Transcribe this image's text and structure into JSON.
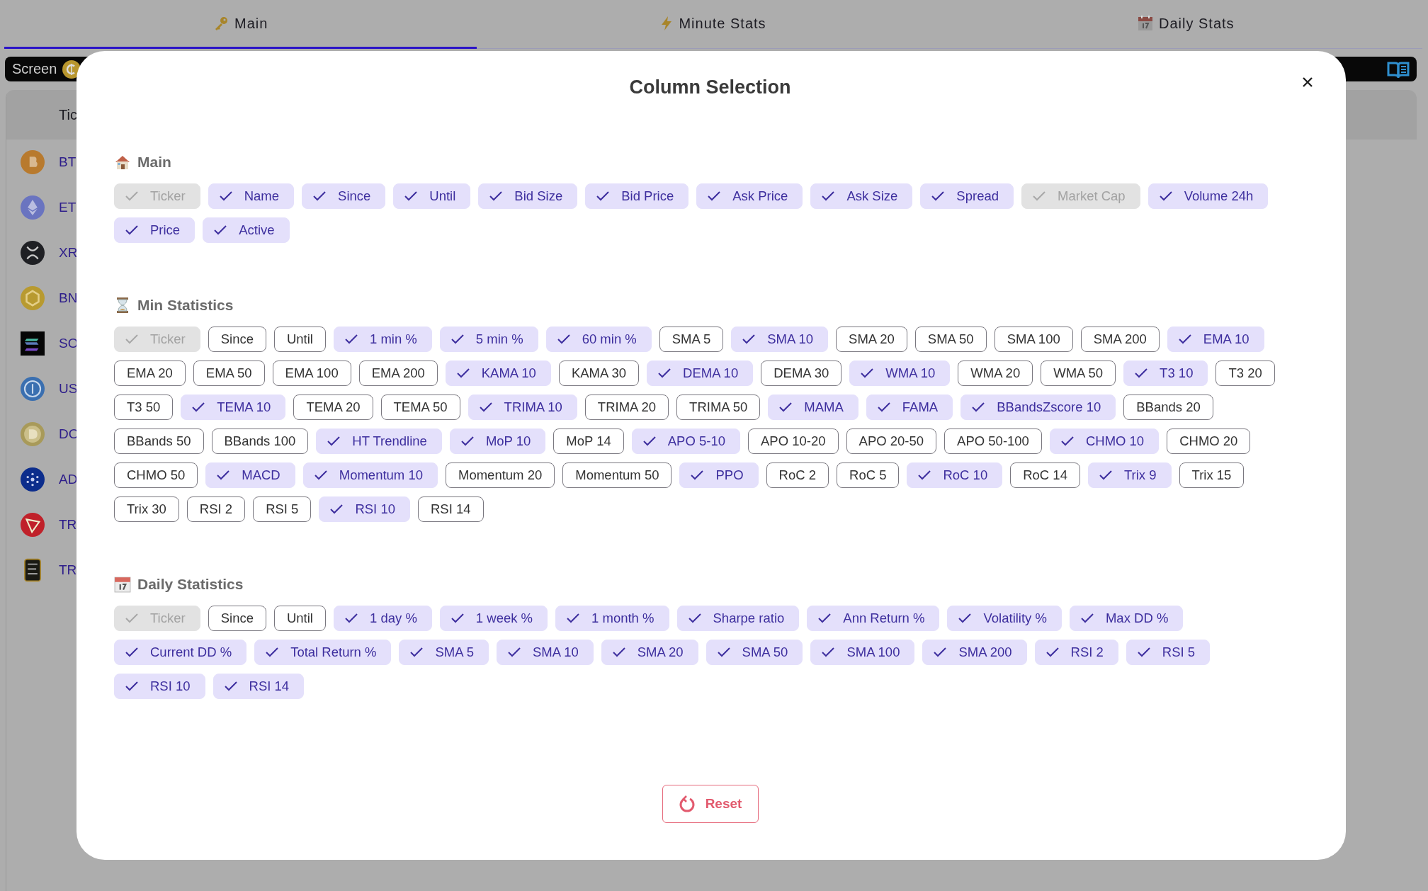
{
  "tabs": [
    {
      "label": "Main",
      "selected": true
    },
    {
      "label": "Minute Stats",
      "selected": false
    },
    {
      "label": "Daily Stats",
      "selected": false
    }
  ],
  "toolbar": {
    "label": "Screen"
  },
  "table": {
    "columns": [
      "Tic"
    ],
    "rows": [
      "BT",
      "ET",
      "XR",
      "BN",
      "SO",
      "US",
      "DO",
      "AD",
      "TR",
      "TR"
    ]
  },
  "modal": {
    "title": "Column Selection",
    "sections": [
      {
        "title": "Main",
        "chips": [
          {
            "label": "Ticker",
            "checked": true,
            "disabled": true
          },
          {
            "label": "Name",
            "checked": true,
            "disabled": false
          },
          {
            "label": "Since",
            "checked": true,
            "disabled": false
          },
          {
            "label": "Until",
            "checked": true,
            "disabled": false
          },
          {
            "label": "Bid Size",
            "checked": true,
            "disabled": false
          },
          {
            "label": "Bid Price",
            "checked": true,
            "disabled": false
          },
          {
            "label": "Ask Price",
            "checked": true,
            "disabled": false
          },
          {
            "label": "Ask Size",
            "checked": true,
            "disabled": false
          },
          {
            "label": "Spread",
            "checked": true,
            "disabled": false
          },
          {
            "label": "Market Cap",
            "checked": true,
            "disabled": true
          },
          {
            "label": "Volume 24h",
            "checked": true,
            "disabled": false
          },
          {
            "label": "Price",
            "checked": true,
            "disabled": false
          },
          {
            "label": "Active",
            "checked": true,
            "disabled": false
          }
        ]
      },
      {
        "title": "Min Statistics",
        "chips": [
          {
            "label": "Ticker",
            "checked": true,
            "disabled": true
          },
          {
            "label": "Since",
            "checked": false,
            "disabled": false
          },
          {
            "label": "Until",
            "checked": false,
            "disabled": false
          },
          {
            "label": "1 min %",
            "checked": true,
            "disabled": false
          },
          {
            "label": "5 min %",
            "checked": true,
            "disabled": false
          },
          {
            "label": "60 min %",
            "checked": true,
            "disabled": false
          },
          {
            "label": "SMA 5",
            "checked": false,
            "disabled": false
          },
          {
            "label": "SMA 10",
            "checked": true,
            "disabled": false
          },
          {
            "label": "SMA 20",
            "checked": false,
            "disabled": false
          },
          {
            "label": "SMA 50",
            "checked": false,
            "disabled": false
          },
          {
            "label": "SMA 100",
            "checked": false,
            "disabled": false
          },
          {
            "label": "SMA 200",
            "checked": false,
            "disabled": false
          },
          {
            "label": "EMA 10",
            "checked": true,
            "disabled": false
          },
          {
            "label": "EMA 20",
            "checked": false,
            "disabled": false
          },
          {
            "label": "EMA 50",
            "checked": false,
            "disabled": false
          },
          {
            "label": "EMA 100",
            "checked": false,
            "disabled": false
          },
          {
            "label": "EMA 200",
            "checked": false,
            "disabled": false
          },
          {
            "label": "KAMA 10",
            "checked": true,
            "disabled": false
          },
          {
            "label": "KAMA 30",
            "checked": false,
            "disabled": false
          },
          {
            "label": "DEMA 10",
            "checked": true,
            "disabled": false
          },
          {
            "label": "DEMA 30",
            "checked": false,
            "disabled": false
          },
          {
            "label": "WMA 10",
            "checked": true,
            "disabled": false
          },
          {
            "label": "WMA 20",
            "checked": false,
            "disabled": false
          },
          {
            "label": "WMA 50",
            "checked": false,
            "disabled": false
          },
          {
            "label": "T3 10",
            "checked": true,
            "disabled": false
          },
          {
            "label": "T3 20",
            "checked": false,
            "disabled": false
          },
          {
            "label": "T3 50",
            "checked": false,
            "disabled": false
          },
          {
            "label": "TEMA 10",
            "checked": true,
            "disabled": false
          },
          {
            "label": "TEMA 20",
            "checked": false,
            "disabled": false
          },
          {
            "label": "TEMA 50",
            "checked": false,
            "disabled": false
          },
          {
            "label": "TRIMA 10",
            "checked": true,
            "disabled": false
          },
          {
            "label": "TRIMA 20",
            "checked": false,
            "disabled": false
          },
          {
            "label": "TRIMA 50",
            "checked": false,
            "disabled": false
          },
          {
            "label": "MAMA",
            "checked": true,
            "disabled": false
          },
          {
            "label": "FAMA",
            "checked": true,
            "disabled": false
          },
          {
            "label": "BBandsZscore 10",
            "checked": true,
            "disabled": false
          },
          {
            "label": "BBands 20",
            "checked": false,
            "disabled": false
          },
          {
            "label": "BBands 50",
            "checked": false,
            "disabled": false
          },
          {
            "label": "BBands 100",
            "checked": false,
            "disabled": false
          },
          {
            "label": "HT Trendline",
            "checked": true,
            "disabled": false
          },
          {
            "label": "MoP 10",
            "checked": true,
            "disabled": false
          },
          {
            "label": "MoP 14",
            "checked": false,
            "disabled": false
          },
          {
            "label": "APO 5-10",
            "checked": true,
            "disabled": false
          },
          {
            "label": "APO 10-20",
            "checked": false,
            "disabled": false
          },
          {
            "label": "APO 20-50",
            "checked": false,
            "disabled": false
          },
          {
            "label": "APO 50-100",
            "checked": false,
            "disabled": false
          },
          {
            "label": "CHMO 10",
            "checked": true,
            "disabled": false
          },
          {
            "label": "CHMO 20",
            "checked": false,
            "disabled": false
          },
          {
            "label": "CHMO 50",
            "checked": false,
            "disabled": false
          },
          {
            "label": "MACD",
            "checked": true,
            "disabled": false
          },
          {
            "label": "Momentum 10",
            "checked": true,
            "disabled": false
          },
          {
            "label": "Momentum 20",
            "checked": false,
            "disabled": false
          },
          {
            "label": "Momentum 50",
            "checked": false,
            "disabled": false
          },
          {
            "label": "PPO",
            "checked": true,
            "disabled": false
          },
          {
            "label": "RoC 2",
            "checked": false,
            "disabled": false
          },
          {
            "label": "RoC 5",
            "checked": false,
            "disabled": false
          },
          {
            "label": "RoC 10",
            "checked": true,
            "disabled": false
          },
          {
            "label": "RoC 14",
            "checked": false,
            "disabled": false
          },
          {
            "label": "Trix 9",
            "checked": true,
            "disabled": false
          },
          {
            "label": "Trix 15",
            "checked": false,
            "disabled": false
          },
          {
            "label": "Trix 30",
            "checked": false,
            "disabled": false
          },
          {
            "label": "RSI 2",
            "checked": false,
            "disabled": false
          },
          {
            "label": "RSI 5",
            "checked": false,
            "disabled": false
          },
          {
            "label": "RSI 10",
            "checked": true,
            "disabled": false
          },
          {
            "label": "RSI 14",
            "checked": false,
            "disabled": false
          }
        ]
      },
      {
        "title": "Daily Statistics",
        "chips": [
          {
            "label": "Ticker",
            "checked": true,
            "disabled": true
          },
          {
            "label": "Since",
            "checked": false,
            "disabled": false
          },
          {
            "label": "Until",
            "checked": false,
            "disabled": false
          },
          {
            "label": "1 day %",
            "checked": true,
            "disabled": false
          },
          {
            "label": "1 week %",
            "checked": true,
            "disabled": false
          },
          {
            "label": "1 month %",
            "checked": true,
            "disabled": false
          },
          {
            "label": "Sharpe ratio",
            "checked": true,
            "disabled": false
          },
          {
            "label": "Ann Return %",
            "checked": true,
            "disabled": false
          },
          {
            "label": "Volatility %",
            "checked": true,
            "disabled": false
          },
          {
            "label": "Max DD %",
            "checked": true,
            "disabled": false
          },
          {
            "label": "Current DD %",
            "checked": true,
            "disabled": false
          },
          {
            "label": "Total Return %",
            "checked": true,
            "disabled": false
          },
          {
            "label": "SMA 5",
            "checked": true,
            "disabled": false
          },
          {
            "label": "SMA 10",
            "checked": true,
            "disabled": false
          },
          {
            "label": "SMA 20",
            "checked": true,
            "disabled": false
          },
          {
            "label": "SMA 50",
            "checked": true,
            "disabled": false
          },
          {
            "label": "SMA 100",
            "checked": true,
            "disabled": false
          },
          {
            "label": "SMA 200",
            "checked": true,
            "disabled": false
          },
          {
            "label": "RSI 2",
            "checked": true,
            "disabled": false
          },
          {
            "label": "RSI 5",
            "checked": true,
            "disabled": false
          },
          {
            "label": "RSI 10",
            "checked": true,
            "disabled": false
          },
          {
            "label": "RSI 14",
            "checked": true,
            "disabled": false
          }
        ]
      }
    ],
    "reset_button": "Reset"
  }
}
